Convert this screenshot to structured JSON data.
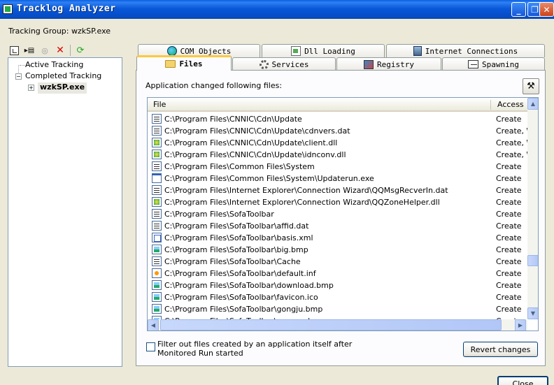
{
  "window": {
    "title": "Tracklog Analyzer",
    "min_glyph": "_",
    "max_glyph": "❐",
    "close_glyph": "✕"
  },
  "tracking_group": {
    "label": "Tracking Group:",
    "value": "wzkSP.exe"
  },
  "tree": {
    "active": "Active Tracking",
    "completed": "Completed Tracking",
    "child": "wzkSP.exe"
  },
  "tabs": {
    "com": "COM Objects",
    "dll": "Dll Loading",
    "internet": "Internet Connections",
    "files": "Files",
    "services": "Services",
    "registry": "Registry",
    "spawning": "Spawning"
  },
  "files_panel": {
    "caption": "Application changed following files:",
    "col_file": "File",
    "col_access": "Access",
    "rows": [
      {
        "icon": "folder",
        "path": "C:\\Program Files\\CNNIC\\Cdn\\Update",
        "access": "Create"
      },
      {
        "icon": "folder",
        "path": "C:\\Program Files\\CNNIC\\Cdn\\Update\\cdnvers.dat",
        "access": "Create, W"
      },
      {
        "icon": "dll",
        "path": "C:\\Program Files\\CNNIC\\Cdn\\Update\\client.dll",
        "access": "Create, W"
      },
      {
        "icon": "dll",
        "path": "C:\\Program Files\\CNNIC\\Cdn\\Update\\idnconv.dll",
        "access": "Create, W"
      },
      {
        "icon": "folder",
        "path": "C:\\Program Files\\Common Files\\System",
        "access": "Create"
      },
      {
        "icon": "exe",
        "path": "C:\\Program Files\\Common Files\\System\\Updaterun.exe",
        "access": "Create"
      },
      {
        "icon": "folder",
        "path": "C:\\Program Files\\Internet Explorer\\Connection Wizard\\QQMsgRecverIn.dat",
        "access": "Create"
      },
      {
        "icon": "dll",
        "path": "C:\\Program Files\\Internet Explorer\\Connection Wizard\\QQZoneHelper.dll",
        "access": "Create"
      },
      {
        "icon": "folder",
        "path": "C:\\Program Files\\SofaToolbar",
        "access": "Create"
      },
      {
        "icon": "folder",
        "path": "C:\\Program Files\\SofaToolbar\\affid.dat",
        "access": "Create"
      },
      {
        "icon": "xml",
        "path": "C:\\Program Files\\SofaToolbar\\basis.xml",
        "access": "Create"
      },
      {
        "icon": "bmp",
        "path": "C:\\Program Files\\SofaToolbar\\big.bmp",
        "access": "Create"
      },
      {
        "icon": "folder",
        "path": "C:\\Program Files\\SofaToolbar\\Cache",
        "access": "Create"
      },
      {
        "icon": "inf",
        "path": "C:\\Program Files\\SofaToolbar\\default.inf",
        "access": "Create"
      },
      {
        "icon": "bmp",
        "path": "C:\\Program Files\\SofaToolbar\\download.bmp",
        "access": "Create"
      },
      {
        "icon": "bmp",
        "path": "C:\\Program Files\\SofaToolbar\\favicon.ico",
        "access": "Create"
      },
      {
        "icon": "bmp",
        "path": "C:\\Program Files\\SofaToolbar\\gongju.bmp",
        "access": "Create"
      },
      {
        "icon": "bmp",
        "path": "C:\\Program Files\\SofaToolbar\\guanyu.bmp",
        "access": "Create"
      }
    ],
    "filter_label_line1": "Filter out files created by an application itself after",
    "filter_label_line2": "Monitored Run started",
    "revert_button": "Revert changes"
  },
  "close_button": "Close"
}
